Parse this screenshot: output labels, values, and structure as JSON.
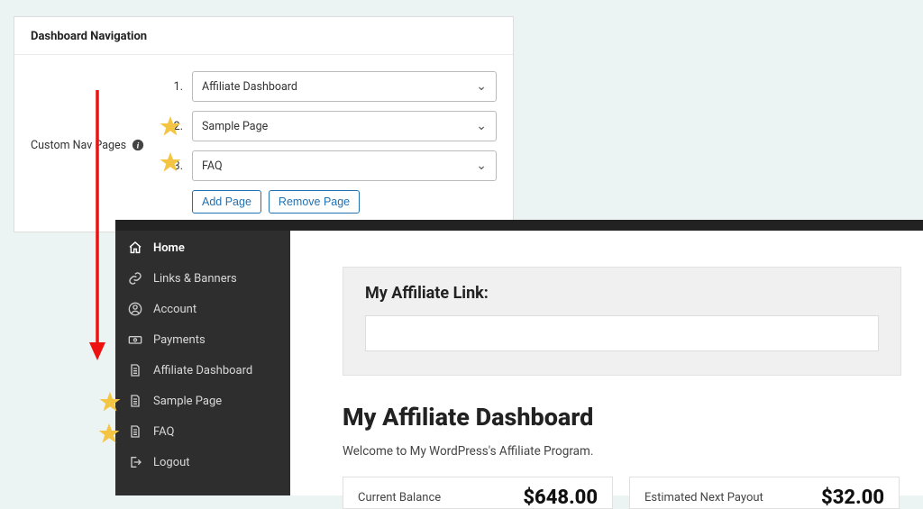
{
  "panel": {
    "title": "Dashboard Navigation",
    "field_label": "Custom Nav Pages",
    "rows": [
      {
        "num": "1.",
        "value": "Affiliate Dashboard"
      },
      {
        "num": "2.",
        "value": "Sample Page"
      },
      {
        "num": "3.",
        "value": "FAQ"
      }
    ],
    "add_label": "Add Page",
    "remove_label": "Remove Page"
  },
  "sidebar": {
    "items": [
      {
        "label": "Home"
      },
      {
        "label": "Links & Banners"
      },
      {
        "label": "Account"
      },
      {
        "label": "Payments"
      },
      {
        "label": "Affiliate Dashboard"
      },
      {
        "label": "Sample Page"
      },
      {
        "label": "FAQ"
      },
      {
        "label": "Logout"
      }
    ]
  },
  "main": {
    "link_heading": "My Affiliate Link:",
    "dashboard_heading": "My Affiliate Dashboard",
    "welcome": "Welcome to My WordPress's Affiliate Program.",
    "stats": {
      "balance_label": "Current Balance",
      "balance_value": "$648.00",
      "payout_label": "Estimated Next Payout",
      "payout_value": "$32.00"
    }
  }
}
